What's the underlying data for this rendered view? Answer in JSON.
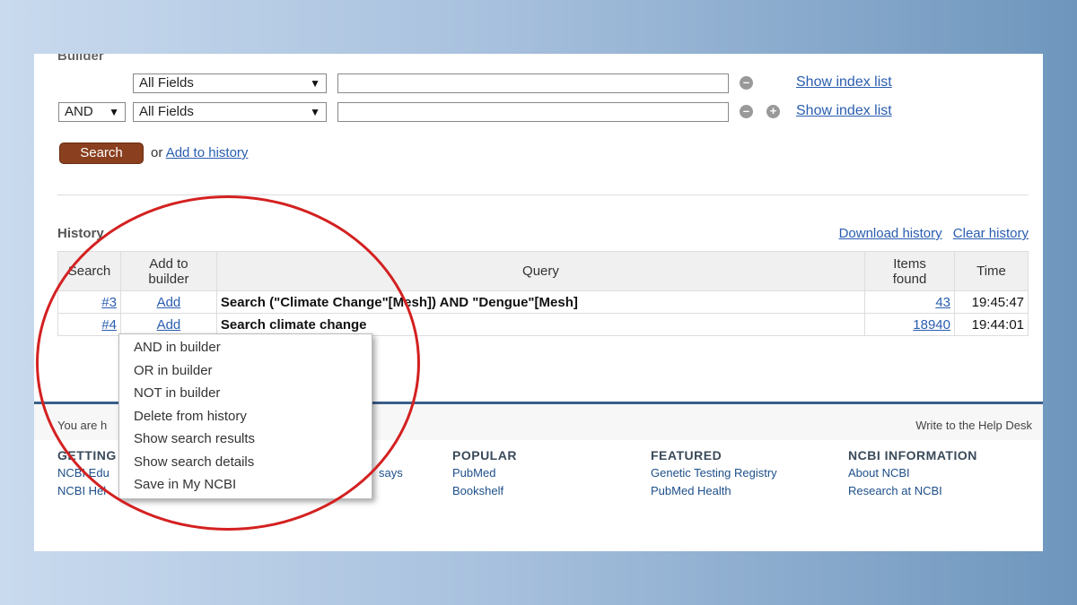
{
  "builder": {
    "title": "Builder",
    "rows": [
      {
        "operator": "",
        "field": "All Fields",
        "value": "",
        "show_index": "Show index list"
      },
      {
        "operator": "AND",
        "field": "All Fields",
        "value": "",
        "show_index": "Show index list"
      }
    ],
    "search_label": "Search",
    "or_text": "or",
    "add_history_label": "Add to history"
  },
  "history": {
    "title": "History",
    "download_label": "Download history",
    "clear_label": "Clear history",
    "headers": {
      "search": "Search",
      "add_to_builder_line1": "Add to",
      "add_to_builder_line2": "builder",
      "query": "Query",
      "items_found_line1": "Items",
      "items_found_line2": "found",
      "time": "Time"
    },
    "rows": [
      {
        "id": "#3",
        "add": "Add",
        "query_prefix": "Search",
        "query": "(\"Climate Change\"[Mesh]) AND \"Dengue\"[Mesh]",
        "items": "43",
        "time": "19:45:47"
      },
      {
        "id": "#4",
        "add": "Add",
        "query_prefix": "Search",
        "query": "climate change",
        "items": "18940",
        "time": "19:44:01"
      }
    ]
  },
  "context_menu": {
    "items": [
      "AND in builder",
      "OR in builder",
      "NOT in builder",
      "Delete from history",
      "Show search results",
      "Show search details",
      "Save in My NCBI"
    ]
  },
  "footer": {
    "you_are": "You are h",
    "help_desk": "Write to the Help Desk",
    "columns": [
      {
        "heading": "GETTING",
        "items": [
          "NCBI Edu",
          "NCBI Hel"
        ]
      },
      {
        "heading": "",
        "items": [
          "says",
          ""
        ]
      },
      {
        "heading": "POPULAR",
        "items": [
          "PubMed",
          "Bookshelf"
        ]
      },
      {
        "heading": "FEATURED",
        "items": [
          "Genetic Testing Registry",
          "PubMed Health"
        ]
      },
      {
        "heading": "NCBI INFORMATION",
        "items": [
          "About NCBI",
          "Research at NCBI"
        ]
      }
    ]
  },
  "colors": {
    "search_button": "#8a3f1e",
    "link": "#2a5db0",
    "annotation_circle": "#d42020",
    "footer_bar": "#3a5f8a"
  }
}
